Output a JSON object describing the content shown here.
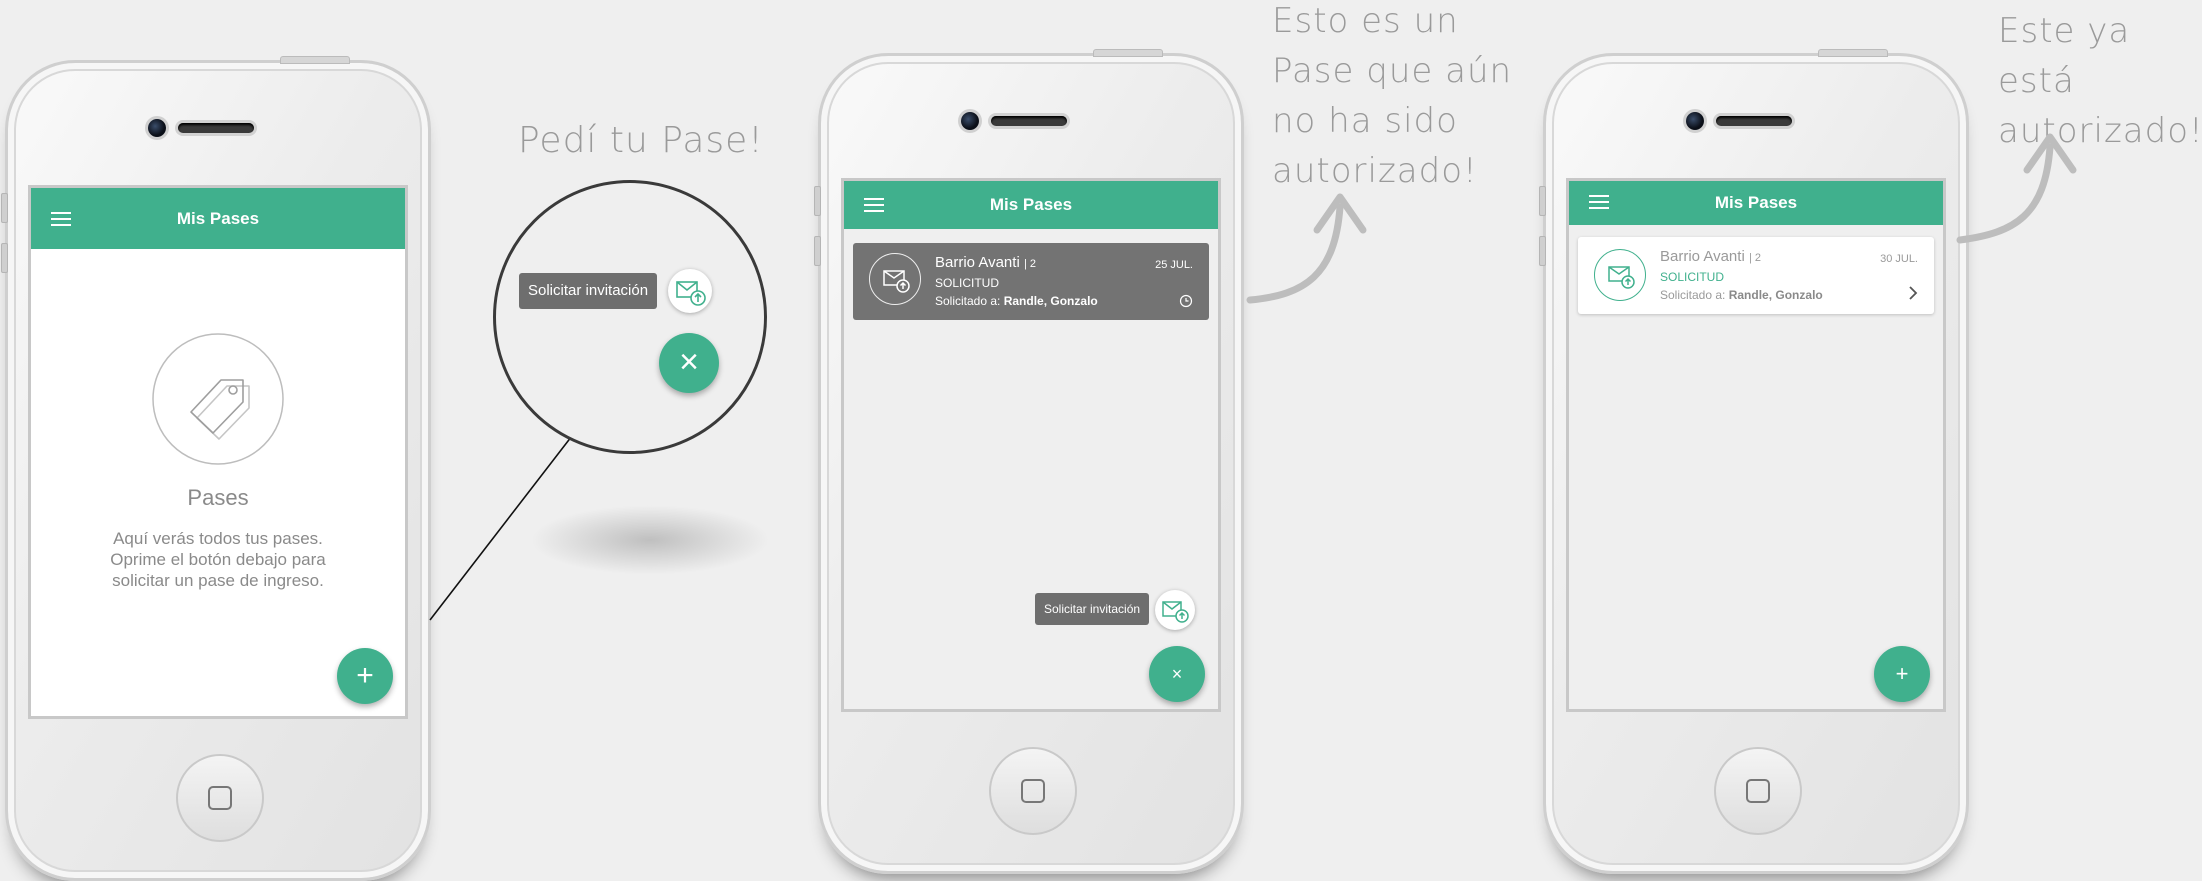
{
  "colors": {
    "accent": "#40b08d",
    "background": "#efefef",
    "card_dark": "#737373"
  },
  "annotations": {
    "pedi_tu_pase": "Pedí tu Pase!",
    "no_autorizado": [
      "Esto es un",
      "Pase que aún",
      "no ha sido",
      "autorizado!"
    ],
    "autorizado": [
      "Este ya está",
      "autorizado!"
    ]
  },
  "phone1": {
    "app_title": "Mis Pases",
    "menu_icon": "hamburger-menu-icon",
    "empty_icon": "tag-icon",
    "empty_title": "Pases",
    "empty_text": [
      "Aquí verás todos tus pases.",
      "Oprime el botón debajo para",
      "solicitar un pase de ingreso."
    ],
    "fab_label": "+",
    "fab_icon": "plus-icon"
  },
  "zoom": {
    "tooltip": "Solicitar invitación",
    "mail_icon": "mail-upload-icon",
    "close_label": "×"
  },
  "phone2": {
    "app_title": "Mis Pases",
    "card": {
      "name": "Barrio Avanti",
      "count": "| 2",
      "type": "SOLICITUD",
      "requested_prefix": "Solicitado a:",
      "requested_to": "Randle, Gonzalo",
      "date": "25 JUL.",
      "status_icon": "clock-icon"
    },
    "tooltip": "Solicitar invitación",
    "close_label": "×"
  },
  "phone3": {
    "app_title": "Mis Pases",
    "card": {
      "name": "Barrio Avanti",
      "count": "| 2",
      "type": "SOLICITUD",
      "requested_prefix": "Solicitado a:",
      "requested_to": "Randle, Gonzalo",
      "date": "30 JUL.",
      "status_icon": "chevron-right-icon"
    },
    "fab_label": "+"
  }
}
